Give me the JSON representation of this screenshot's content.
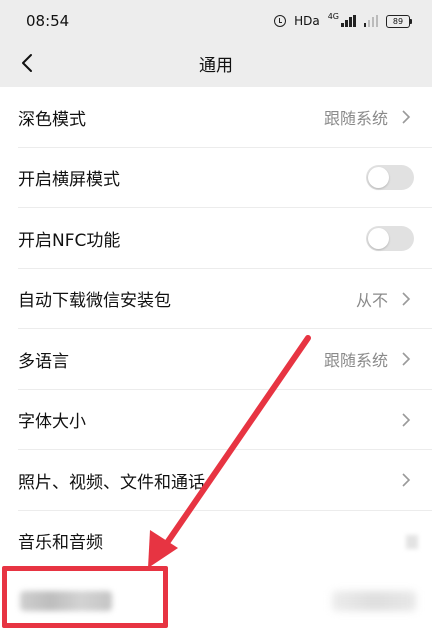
{
  "status_bar": {
    "time": "08:54",
    "network_label": "HDa",
    "network_type": "4G",
    "battery": "89"
  },
  "nav": {
    "title": "通用",
    "back_icon": "chevron-left-icon"
  },
  "settings": [
    {
      "label": "深色模式",
      "value": "跟随系统",
      "type": "link"
    },
    {
      "label": "开启横屏模式",
      "type": "toggle",
      "on": false
    },
    {
      "label": "开启NFC功能",
      "type": "toggle",
      "on": false
    },
    {
      "label": "自动下载微信安装包",
      "value": "从不",
      "type": "link"
    },
    {
      "label": "多语言",
      "value": "跟随系统",
      "type": "link"
    },
    {
      "label": "字体大小",
      "type": "link"
    },
    {
      "label": "照片、视频、文件和通话",
      "type": "link"
    },
    {
      "label": "音乐和音频",
      "type": "link"
    }
  ],
  "colors": {
    "annotation": "#e73442",
    "background": "#ededed",
    "toggle_off": "#e1e1e1"
  }
}
